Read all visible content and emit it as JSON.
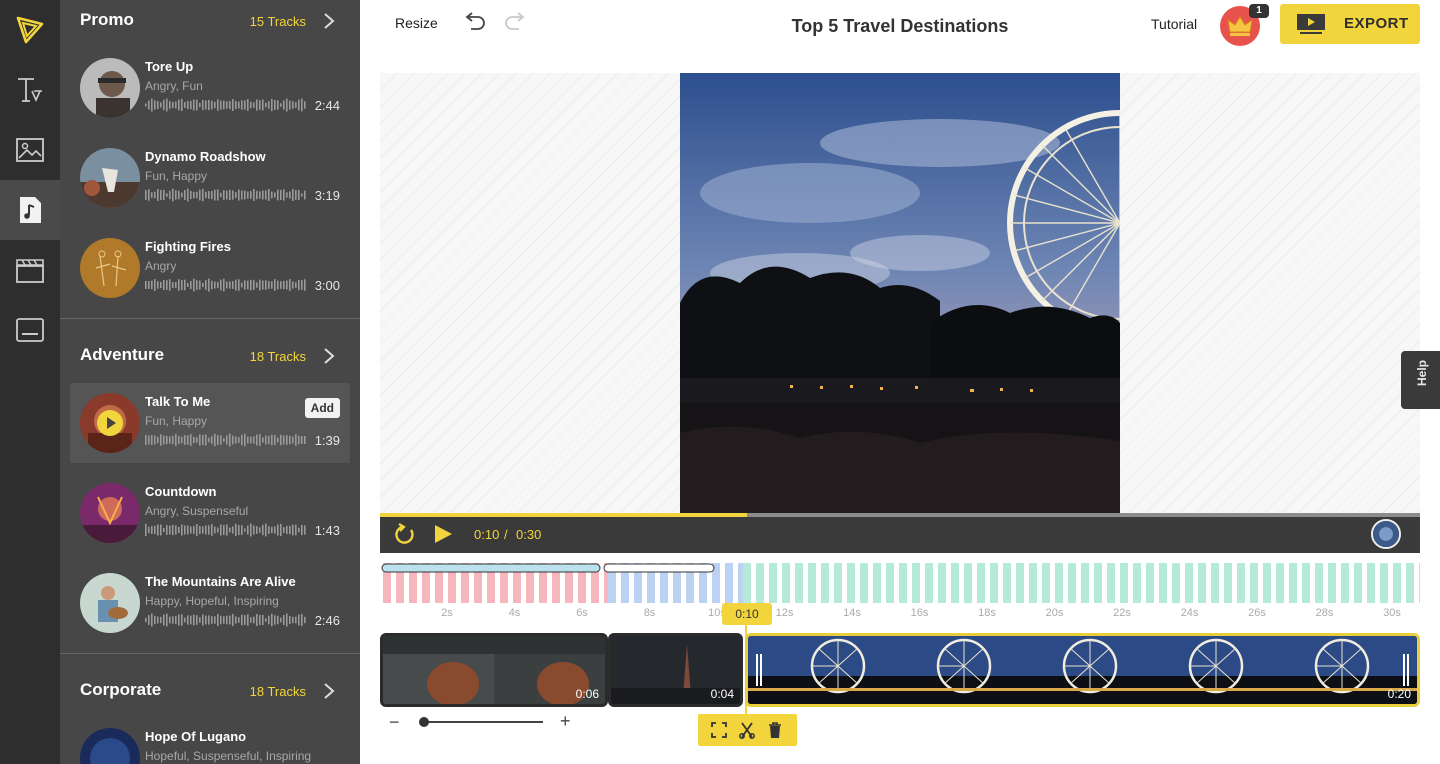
{
  "app": {
    "title": "Top 5 Travel Destinations",
    "accent": "#f2d53c"
  },
  "rail": {
    "items": [
      {
        "icon": "logo-icon"
      },
      {
        "icon": "text-icon"
      },
      {
        "icon": "image-icon"
      },
      {
        "icon": "music-icon",
        "active": true
      },
      {
        "icon": "clapperboard-icon"
      },
      {
        "icon": "subtitles-icon"
      }
    ]
  },
  "toolbar": {
    "resize_label": "Resize",
    "tutorial_label": "Tutorial",
    "notification_count": "1",
    "export_label": "EXPORT"
  },
  "music": {
    "categories": [
      {
        "name": "Promo",
        "count": "15 Tracks",
        "tracks": [
          {
            "name": "Tore Up",
            "tags": "Angry, Fun",
            "duration": "2:44"
          },
          {
            "name": "Dynamo Roadshow",
            "tags": "Fun, Happy",
            "duration": "3:19"
          },
          {
            "name": "Fighting Fires",
            "tags": "Angry",
            "duration": "3:00"
          }
        ]
      },
      {
        "name": "Adventure",
        "count": "18 Tracks",
        "tracks": [
          {
            "name": "Talk To Me",
            "tags": "Fun, Happy",
            "duration": "1:39",
            "add_label": "Add"
          },
          {
            "name": "Countdown",
            "tags": "Angry, Suspenseful",
            "duration": "1:43"
          },
          {
            "name": "The Mountains Are Alive",
            "tags": "Happy, Hopeful, Inspiring",
            "duration": "2:46"
          }
        ]
      },
      {
        "name": "Corporate",
        "count": "18 Tracks",
        "tracks": [
          {
            "name": "Hope Of Lugano",
            "tags": "Hopeful, Suspenseful, Inspiring",
            "duration": ""
          }
        ]
      }
    ]
  },
  "player": {
    "current_time": "0:10",
    "separator": "/",
    "total_time": "0:30",
    "progress_fraction": 0.353
  },
  "timeline": {
    "ticks": [
      "2s",
      "4s",
      "6s",
      "8s",
      "10s",
      "12s",
      "14s",
      "16s",
      "18s",
      "20s",
      "22s",
      "24s",
      "26s",
      "28s",
      "30s"
    ],
    "playhead_label": "0:10",
    "clips": [
      {
        "duration": "0:06"
      },
      {
        "duration": "0:04"
      },
      {
        "duration": "0:20",
        "selected": true
      }
    ]
  },
  "help": {
    "label": "Help"
  }
}
